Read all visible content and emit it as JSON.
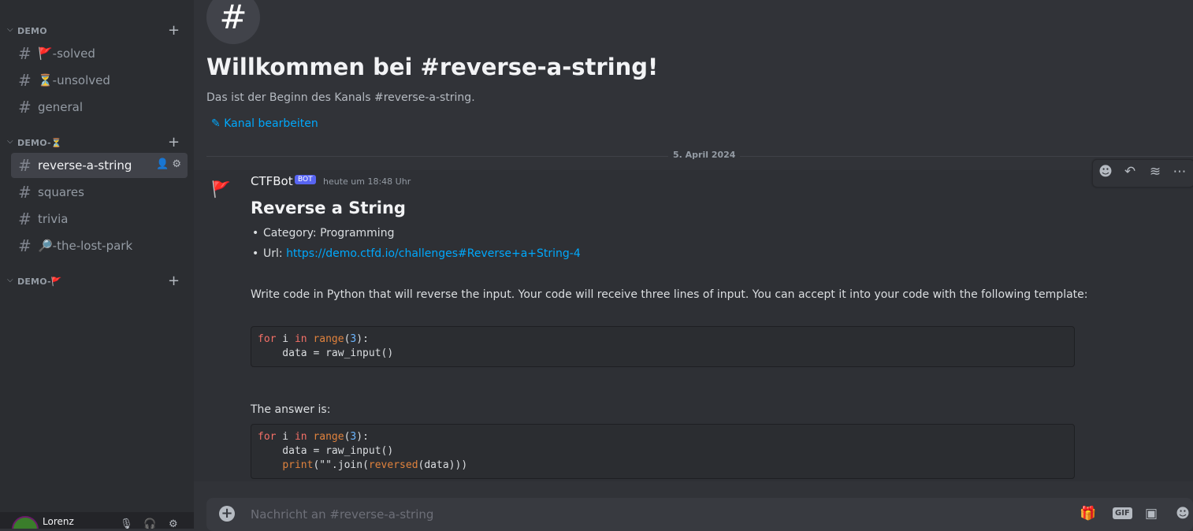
{
  "sidebar": {
    "top_partial": "…",
    "categories": [
      {
        "label": "DEMO",
        "channels": [
          {
            "label": "🚩-solved"
          },
          {
            "label": "⏳-unsolved"
          },
          {
            "label": "general"
          }
        ]
      },
      {
        "label": "DEMO-⏳",
        "channels": [
          {
            "label": "reverse-a-string",
            "active": true
          },
          {
            "label": "squares"
          },
          {
            "label": "trivia"
          },
          {
            "label": "🔎-the-lost-park"
          }
        ]
      },
      {
        "label": "DEMO-🚩",
        "channels": []
      }
    ],
    "user": {
      "name": "Lorenz"
    }
  },
  "main": {
    "welcome_title": "Willkommen bei #reverse-a-string!",
    "welcome_sub": "Das ist der Beginn des Kanals #reverse-a-string.",
    "edit_link": "Kanal bearbeiten",
    "date_divider": "5. April 2024",
    "message": {
      "author": "CTFBot",
      "badge": "BOT",
      "timestamp": "heute um 18:48 Uhr",
      "embed_title": "Reverse a String",
      "category_line": "Category: Programming",
      "url_prefix": "Url: ",
      "url": "https://demo.ctfd.io/challenges#Reverse+a+String-4",
      "paragraph": "Write code in Python that will reverse the input. Your code will receive three lines of input. You can accept it into your code with the following template:",
      "answer_label": "The answer is:"
    },
    "chat_placeholder": "Nachricht an #reverse-a-string",
    "icons": {
      "hash": "#",
      "emoji": "emoji-icon",
      "reply": "reply-icon",
      "thread": "thread-icon",
      "more": "more-icon",
      "gift": "gift-icon",
      "gif": "GIF",
      "sticker": "sticker-icon"
    }
  },
  "colors": {
    "accent": "#5865f2",
    "link": "#00a8fc",
    "bg": "#313338",
    "sidebar": "#2b2d31"
  }
}
